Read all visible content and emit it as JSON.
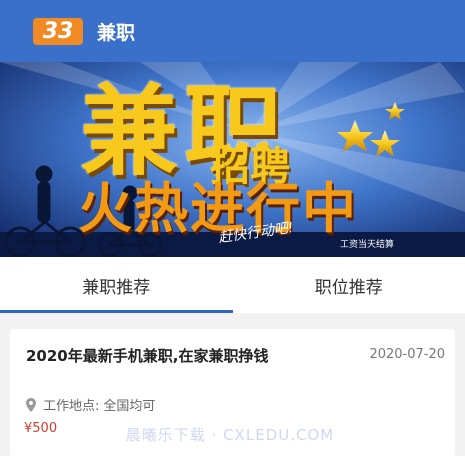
{
  "header": {
    "logo_text": "33",
    "title": "兼职",
    "bg_color": "#3a6fca",
    "logo_color": "#f08a24"
  },
  "banner": {
    "main_text": "兼职",
    "sub_text": "招聘",
    "slogan": "火热进行中",
    "handwriting": "赶快行动吧!",
    "corner_text": "工资当天结算"
  },
  "tabs": [
    {
      "label": "兼职推荐",
      "active": true
    },
    {
      "label": "职位推荐",
      "active": false
    }
  ],
  "jobs": [
    {
      "title": "2020年最新手机兼职,在家兼职挣钱",
      "date": "2020-07-20",
      "location_label": "工作地点:",
      "location_value": "全国均可",
      "salary": "¥500"
    }
  ],
  "watermark": "晨曦乐下载 · CXLEDU.COM"
}
